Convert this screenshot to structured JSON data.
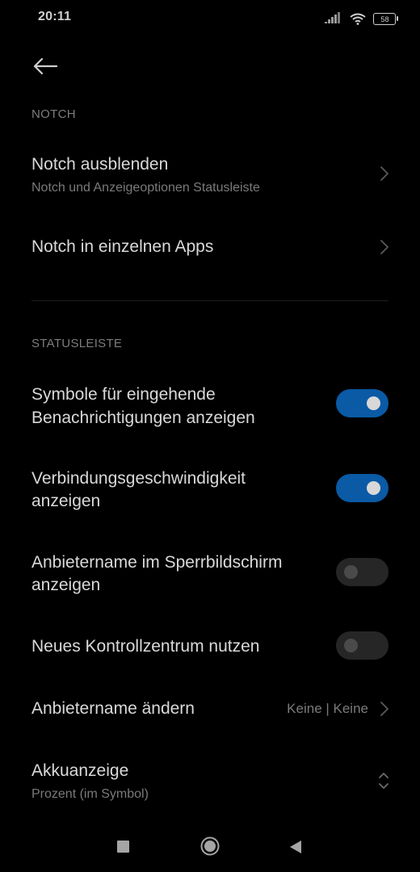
{
  "status_bar": {
    "time": "20:11",
    "battery": "58"
  },
  "sections": {
    "notch_header": "NOTCH",
    "statusbar_header": "STATUSLEISTE"
  },
  "items": {
    "notch_hide": {
      "title": "Notch ausblenden",
      "subtitle": "Notch und Anzeigeoptionen Statusleiste"
    },
    "notch_apps": {
      "title": "Notch in einzelnen Apps"
    },
    "incoming_icons": {
      "title_line1": "Symbole für eingehende",
      "title_line2": "Benachrichtigungen anzeigen",
      "enabled": true
    },
    "connection_speed": {
      "title_line1": "Verbindungsgeschwindigkeit",
      "title_line2": "anzeigen",
      "enabled": true
    },
    "carrier_lockscreen": {
      "title_line1": "Anbietername im Sperrbildschirm",
      "title_line2": "anzeigen",
      "enabled": false
    },
    "new_control_center": {
      "title": "Neues Kontrollzentrum nutzen",
      "enabled": false
    },
    "carrier_name": {
      "title": "Anbietername ändern",
      "value": "Keine | Keine"
    },
    "battery_indicator": {
      "title": "Akkuanzeige",
      "subtitle": "Prozent (im Symbol)"
    }
  },
  "colors": {
    "toggle_on": "#0a5aa5",
    "background": "#000000"
  },
  "icons": {
    "back": "arrow-left-icon",
    "signal": "signal-bars-icon",
    "wifi": "wifi-icon",
    "battery": "battery-icon",
    "chevron": "chevron-right-icon",
    "updown": "chevron-up-down-icon",
    "nav_recents": "square-icon",
    "nav_home": "circle-icon",
    "nav_back": "triangle-back-icon"
  }
}
